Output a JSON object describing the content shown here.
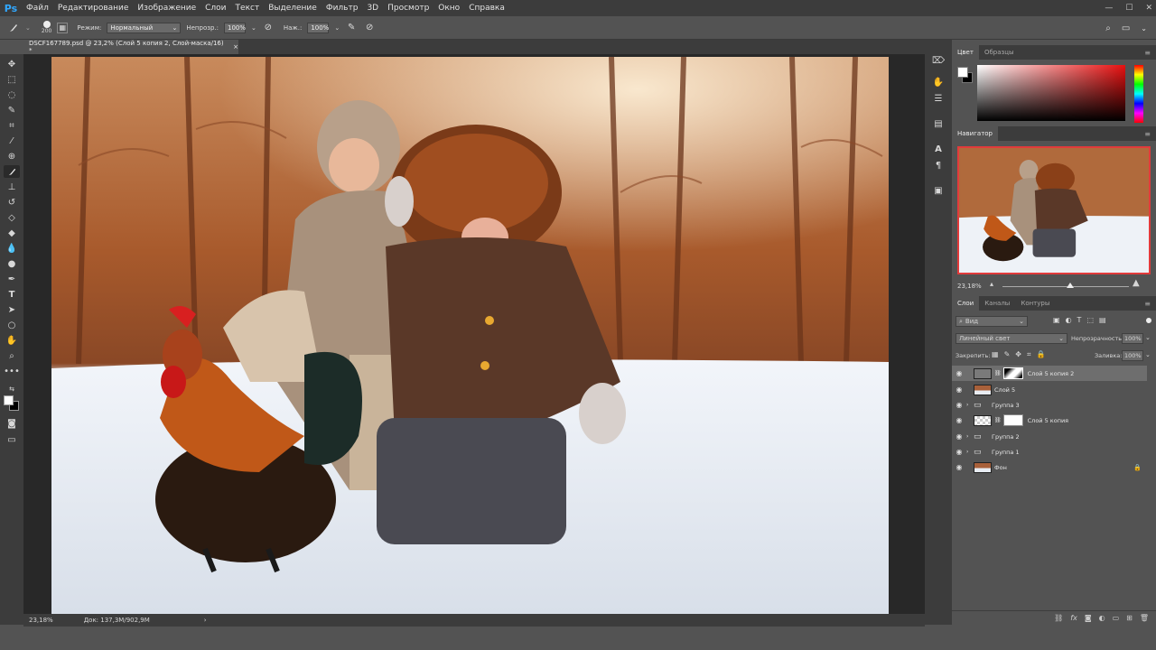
{
  "menubar": {
    "logo": "Ps",
    "items": [
      "Файл",
      "Редактирование",
      "Изображение",
      "Слои",
      "Текст",
      "Выделение",
      "Фильтр",
      "3D",
      "Просмотр",
      "Окно",
      "Справка"
    ],
    "min": "—",
    "max": "☐",
    "close": "✕"
  },
  "options": {
    "brush_size": "200",
    "mode_label": "Режим:",
    "mode_value": "Нормальный",
    "opacity_label": "Непрозр.:",
    "opacity_value": "100%",
    "flow_label": "Наж.:",
    "flow_value": "100%"
  },
  "document": {
    "tab_title": "DSCF167789.psd @ 23,2% (Слой 5 копия 2, Слой-маска/16) *",
    "close": "×"
  },
  "status": {
    "zoom": "23,18%",
    "doc_info": "Док: 137,3M/902,9M",
    "arrow": "›"
  },
  "color_panel": {
    "tabs": [
      "Цвет",
      "Образцы"
    ]
  },
  "navigator": {
    "tab": "Навигатор",
    "zoom": "23,18%",
    "zoom_level": 0.23
  },
  "layers_panel": {
    "tabs": [
      "Слои",
      "Каналы",
      "Контуры"
    ],
    "filter_label": "Вид",
    "blend_mode": "Линейный свет",
    "opacity_label": "Непрозрачность:",
    "opacity_value": "100%",
    "lock_label": "Закрепить:",
    "fill_label": "Заливка:",
    "fill_value": "100%",
    "layers": [
      {
        "name": "Слой 5 копия 2",
        "type": "masked",
        "selected": true
      },
      {
        "name": "Слой 5",
        "type": "image"
      },
      {
        "name": "Группа 3",
        "type": "group"
      },
      {
        "name": "Слой 5 копия",
        "type": "masked-transparent"
      },
      {
        "name": "Группа 2",
        "type": "group"
      },
      {
        "name": "Группа 1",
        "type": "group"
      },
      {
        "name": "Фон",
        "type": "background",
        "locked": true
      }
    ]
  },
  "colors": {
    "accent": "#31a8ff",
    "panel_dark": "#3c3c3c",
    "panel": "#535353"
  }
}
